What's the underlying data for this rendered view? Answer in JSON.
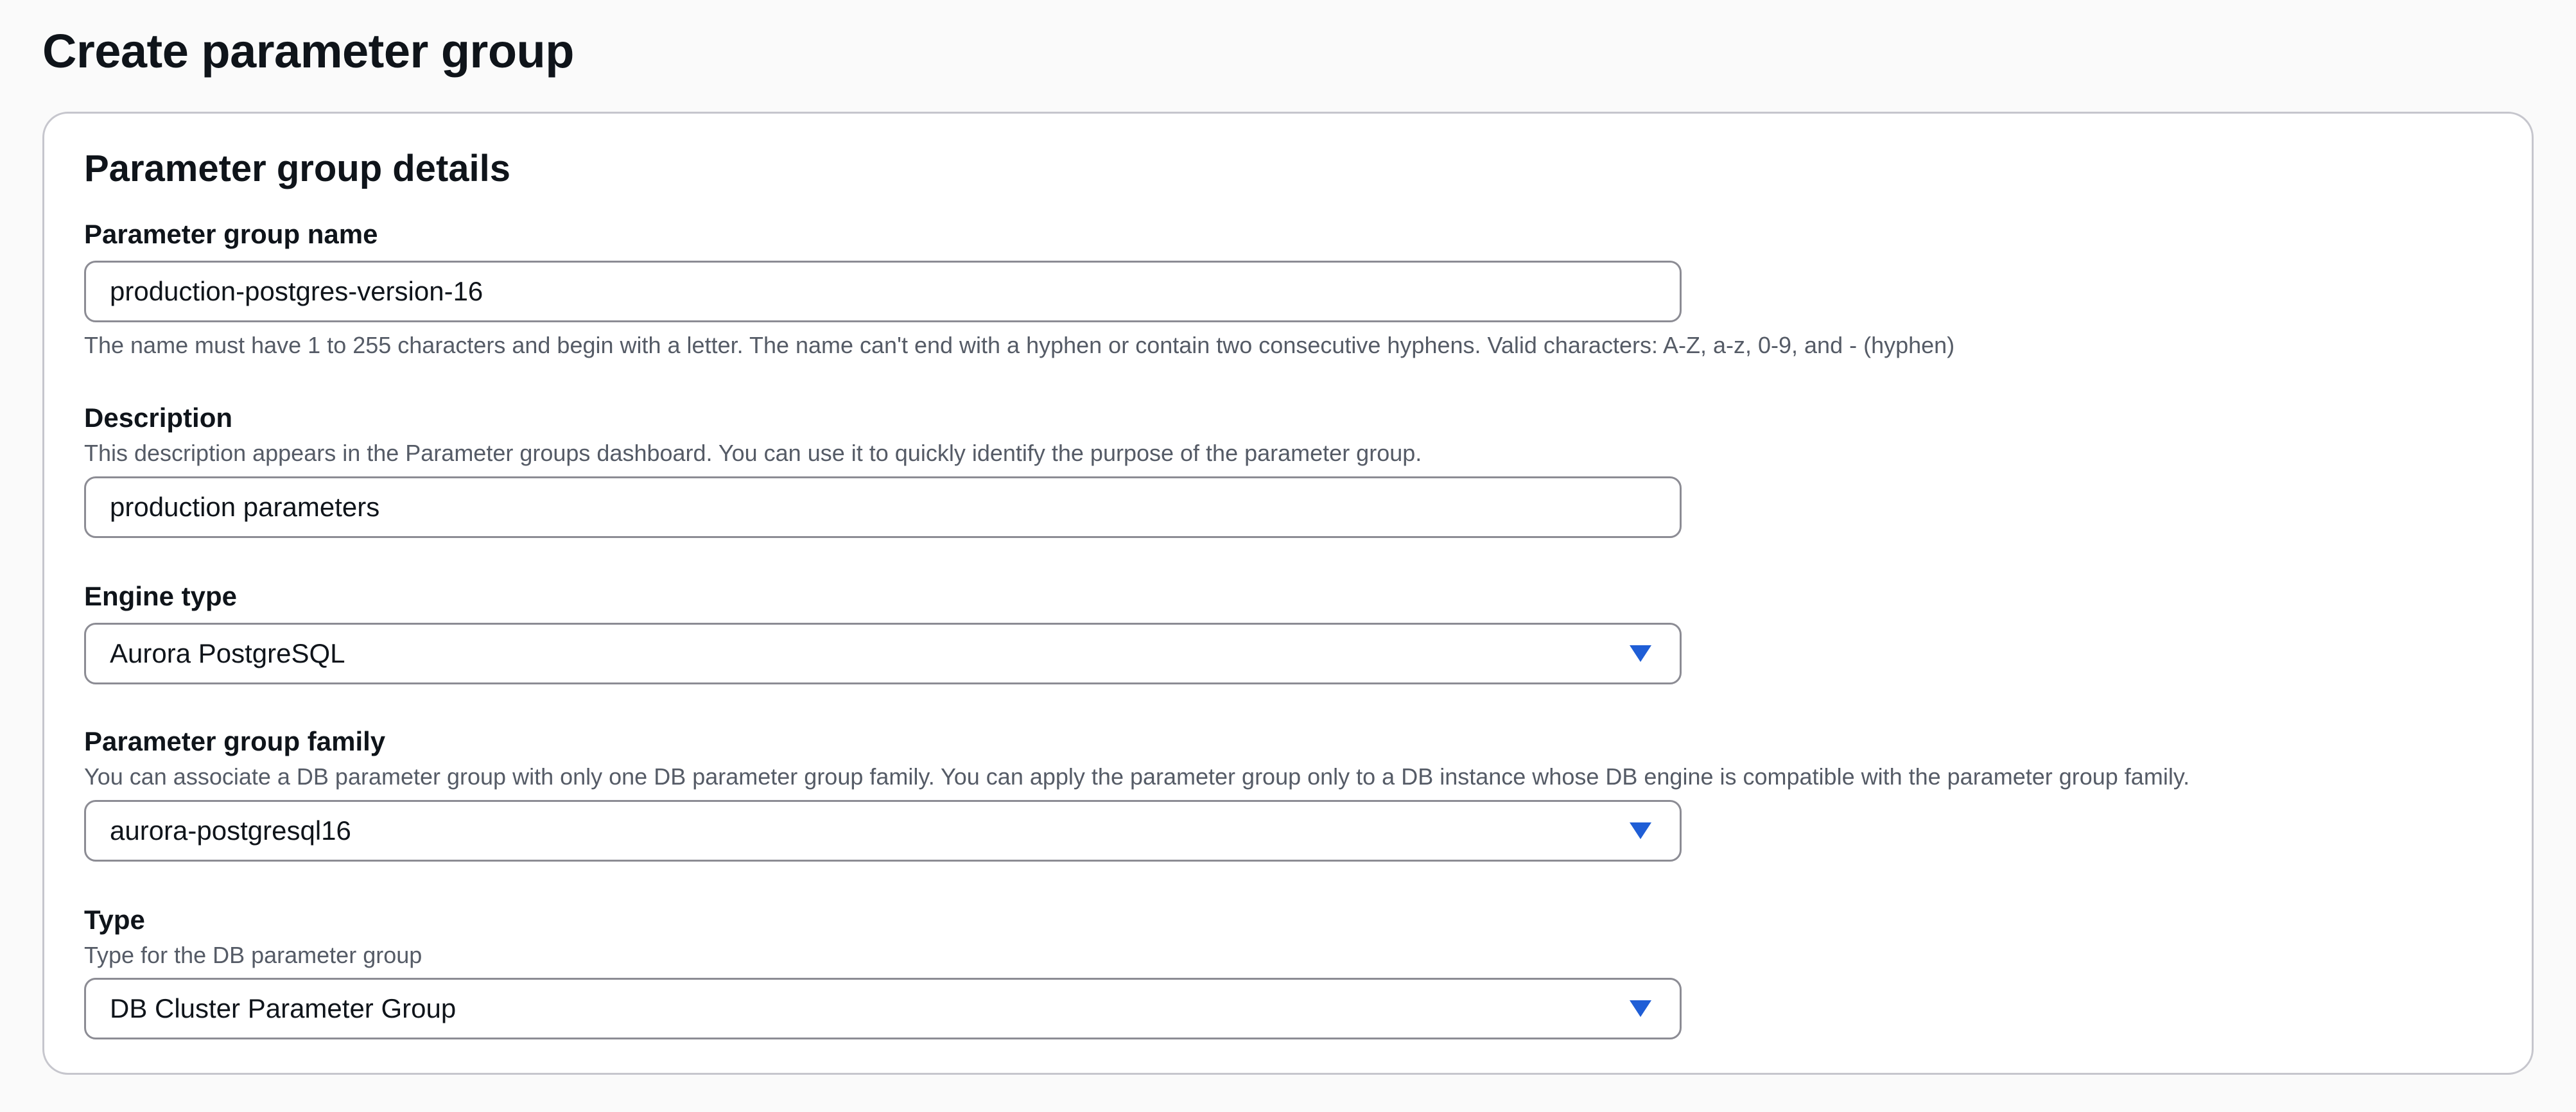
{
  "page": {
    "title": "Create parameter group"
  },
  "panel": {
    "title": "Parameter group details"
  },
  "fields": {
    "name": {
      "label": "Parameter group name",
      "value": "production-postgres-version-16",
      "hint": "The name must have 1 to 255 characters and begin with a letter. The name can't end with a hyphen or contain two consecutive hyphens. Valid characters: A-Z, a-z, 0-9, and - (hyphen)"
    },
    "description": {
      "label": "Description",
      "help": "This description appears in the Parameter groups dashboard. You can use it to quickly identify the purpose of the parameter group.",
      "value": "production parameters"
    },
    "engine_type": {
      "label": "Engine type",
      "selected": "Aurora PostgreSQL",
      "icon": "caret-down-icon"
    },
    "family": {
      "label": "Parameter group family",
      "help": "You can associate a DB parameter group with only one DB parameter group family. You can apply the parameter group only to a DB instance whose DB engine is compatible with the parameter group family.",
      "selected": "aurora-postgresql16",
      "icon": "caret-down-icon"
    },
    "type": {
      "label": "Type",
      "help": "Type for the DB parameter group",
      "selected": "DB Cluster Parameter Group",
      "icon": "caret-down-icon"
    }
  },
  "colors": {
    "accent": "#1f5ed6",
    "border": "#8c8c94",
    "panel_border": "#c6c6cd",
    "secondary_text": "#555b66"
  }
}
